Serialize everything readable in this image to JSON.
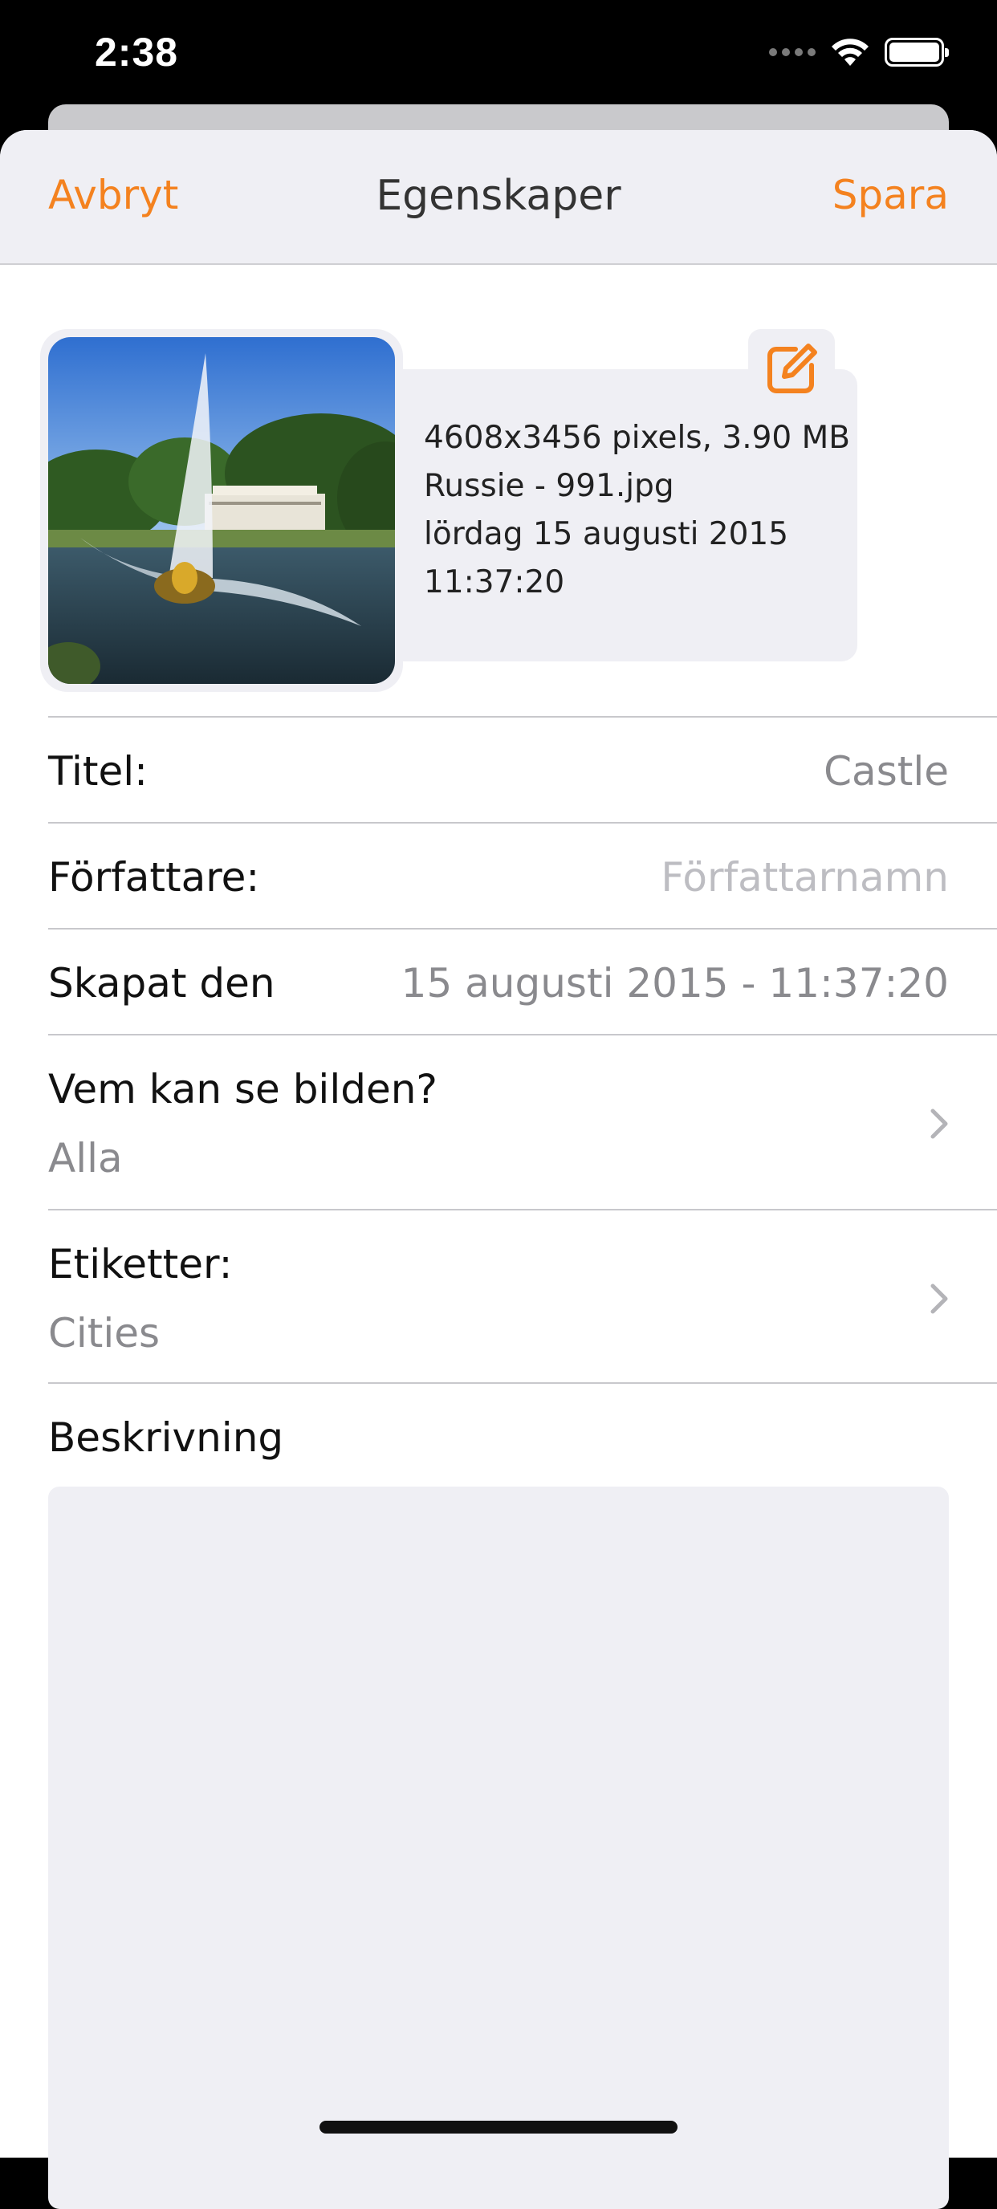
{
  "status_bar": {
    "time": "2:38"
  },
  "nav": {
    "cancel_label": "Avbryt",
    "title": "Egenskaper",
    "save_label": "Spara"
  },
  "image_info": {
    "dimensions_size": "4608x3456 pixels, 3.90 MB",
    "filename": "Russie - 991.jpg",
    "date": "lördag 15 augusti 2015",
    "time": "11:37:20"
  },
  "fields": {
    "title": {
      "label": "Titel:",
      "value": "Castle"
    },
    "author": {
      "label": "Författare:",
      "placeholder": "Författarnamn"
    },
    "created": {
      "label": "Skapat den",
      "value": "15 augusti 2015 - 11:37:20"
    },
    "visibility": {
      "label": "Vem kan se bilden?",
      "value": "Alla"
    },
    "tags": {
      "label": "Etiketter:",
      "value": "Cities"
    },
    "description": {
      "label": "Beskrivning"
    }
  },
  "colors": {
    "accent": "#f4821f",
    "background_gray": "#efeff4"
  },
  "icons": {
    "edit": "edit-square-icon",
    "chevron": "chevron-right-icon"
  }
}
